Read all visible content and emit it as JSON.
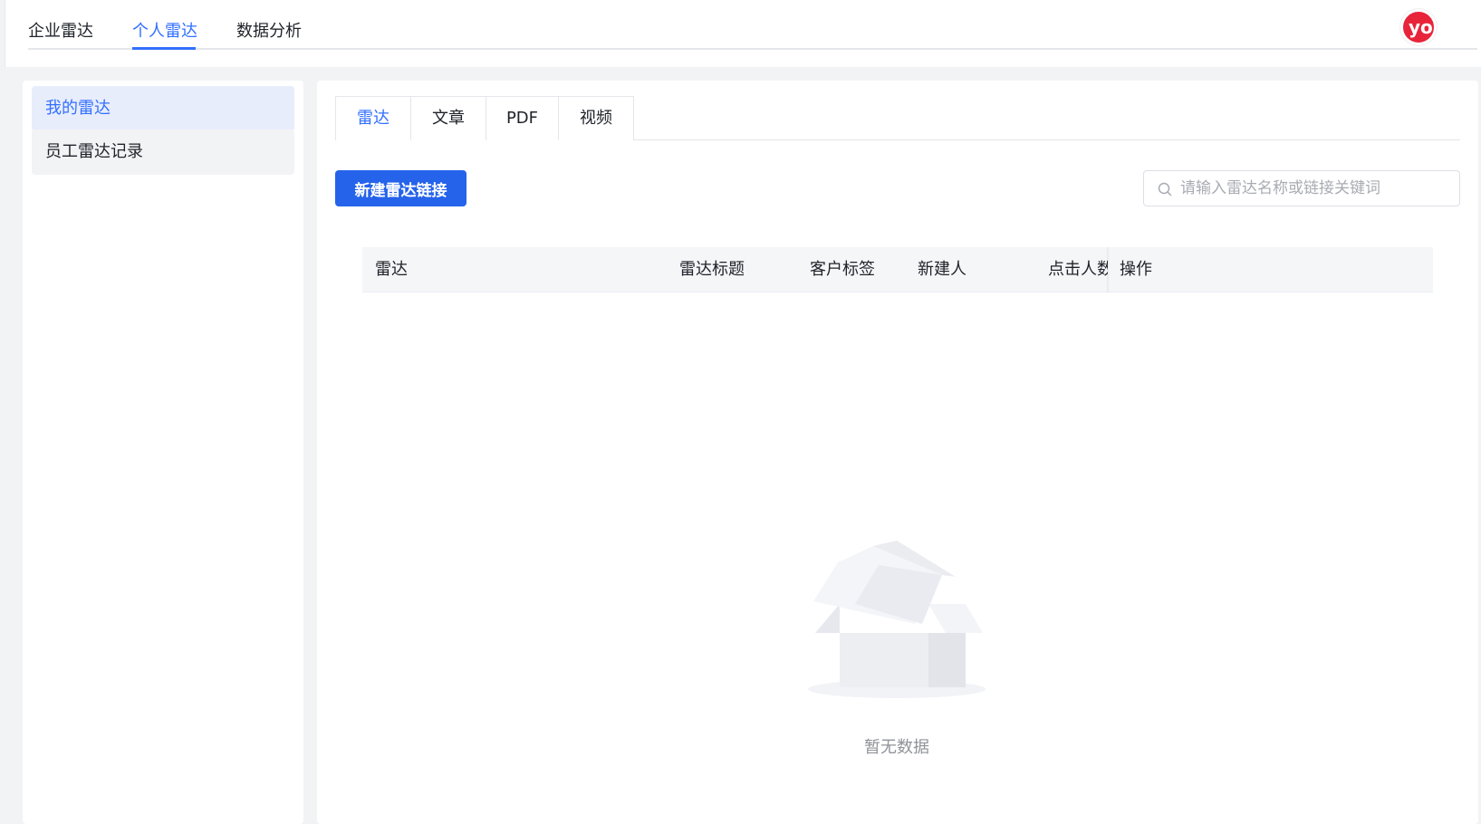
{
  "top_nav": {
    "tabs": [
      "企业雷达",
      "个人雷达",
      "数据分析"
    ],
    "active_tab": "个人雷达"
  },
  "avatar": {
    "text": "yo"
  },
  "sidebar": {
    "items": [
      {
        "label": "我的雷达",
        "active": true
      },
      {
        "label": "员工雷达记录",
        "active": false
      }
    ]
  },
  "content_tabs": {
    "items": [
      "雷达",
      "文章",
      "PDF",
      "视频"
    ],
    "active": "雷达"
  },
  "toolbar": {
    "new_button_label": "新建雷达链接",
    "search_placeholder": "请输入雷达名称或链接关键词",
    "search_value": ""
  },
  "table": {
    "columns": [
      "雷达",
      "雷达标题",
      "客户标签",
      "新建人",
      "点击人数",
      "操作"
    ],
    "rows": []
  },
  "empty_state": {
    "text": "暂无数据",
    "icon": "empty-box-icon"
  },
  "colors": {
    "accent": "#3370ff",
    "primary_button": "#2563eb",
    "sidebar_active_bg": "#e8edfc",
    "page_bg": "#f2f3f5"
  }
}
